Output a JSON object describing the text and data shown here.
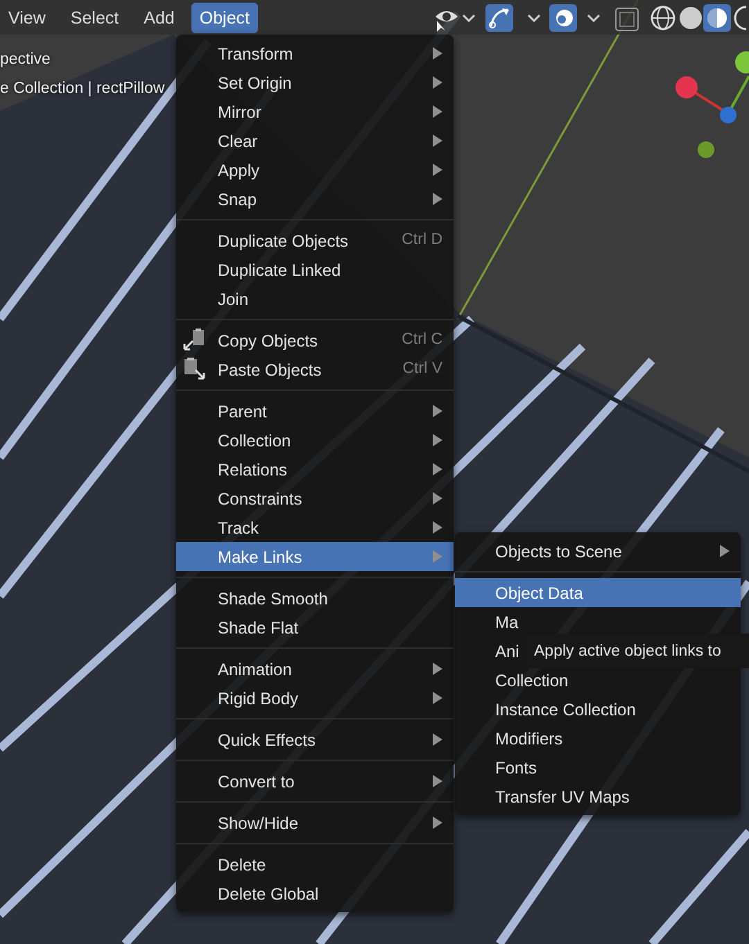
{
  "header": {
    "menus": [
      {
        "label": "View",
        "selected": false
      },
      {
        "label": "Select",
        "selected": false
      },
      {
        "label": "Add",
        "selected": false
      },
      {
        "label": "Object",
        "selected": true
      }
    ]
  },
  "viewport_overlay": [
    "pective",
    "e Collection | rectPillow"
  ],
  "object_menu": {
    "groups": [
      {
        "items": [
          {
            "label": "Transform",
            "submenu": true,
            "selected": false
          },
          {
            "label": "Set Origin",
            "submenu": true,
            "selected": false
          },
          {
            "label": "Mirror",
            "submenu": true,
            "selected": false
          },
          {
            "label": "Clear",
            "submenu": true,
            "selected": false
          },
          {
            "label": "Apply",
            "submenu": true,
            "selected": false
          },
          {
            "label": "Snap",
            "submenu": true,
            "selected": false
          }
        ]
      },
      {
        "items": [
          {
            "label": "Duplicate Objects",
            "shortcut": "Ctrl D",
            "submenu": false,
            "selected": false
          },
          {
            "label": "Duplicate Linked",
            "submenu": false,
            "selected": false
          },
          {
            "label": "Join",
            "submenu": false,
            "selected": false
          }
        ]
      },
      {
        "items": [
          {
            "label": "Copy Objects",
            "shortcut": "Ctrl C",
            "kind": "copy",
            "submenu": false,
            "selected": false
          },
          {
            "label": "Paste Objects",
            "shortcut": "Ctrl V",
            "kind": "paste",
            "submenu": false,
            "selected": false
          }
        ]
      },
      {
        "items": [
          {
            "label": "Parent",
            "submenu": true,
            "selected": false
          },
          {
            "label": "Collection",
            "submenu": true,
            "selected": false
          },
          {
            "label": "Relations",
            "submenu": true,
            "selected": false
          },
          {
            "label": "Constraints",
            "submenu": true,
            "selected": false
          },
          {
            "label": "Track",
            "submenu": true,
            "selected": false
          },
          {
            "label": "Make Links",
            "submenu": true,
            "selected": true
          }
        ]
      },
      {
        "items": [
          {
            "label": "Shade Smooth",
            "submenu": false,
            "selected": false
          },
          {
            "label": "Shade Flat",
            "submenu": false,
            "selected": false
          }
        ]
      },
      {
        "items": [
          {
            "label": "Animation",
            "submenu": true,
            "selected": false
          },
          {
            "label": "Rigid Body",
            "submenu": true,
            "selected": false
          }
        ]
      },
      {
        "items": [
          {
            "label": "Quick Effects",
            "submenu": true,
            "selected": false
          }
        ]
      },
      {
        "items": [
          {
            "label": "Convert to",
            "submenu": true,
            "selected": false
          }
        ]
      },
      {
        "items": [
          {
            "label": "Show/Hide",
            "submenu": true,
            "selected": false
          }
        ]
      },
      {
        "items": [
          {
            "label": "Delete",
            "submenu": false,
            "selected": false
          },
          {
            "label": "Delete Global",
            "submenu": false,
            "selected": false
          }
        ]
      }
    ]
  },
  "make_links_menu": {
    "groups": [
      {
        "items": [
          {
            "label": "Objects to Scene",
            "submenu": true,
            "selected": false
          }
        ]
      },
      {
        "items": [
          {
            "label": "Object Data",
            "submenu": false,
            "selected": true
          },
          {
            "label": "Ma",
            "submenu": false,
            "selected": false
          },
          {
            "label": "Ani",
            "submenu": false,
            "selected": false
          },
          {
            "label": "Collection",
            "submenu": false,
            "selected": false
          },
          {
            "label": "Instance Collection",
            "submenu": false,
            "selected": false
          },
          {
            "label": "Modifiers",
            "submenu": false,
            "selected": false
          },
          {
            "label": "Fonts",
            "submenu": false,
            "selected": false
          },
          {
            "label": "Transfer UV Maps",
            "submenu": false,
            "selected": false
          }
        ]
      }
    ]
  },
  "tooltip": "Apply active object links to"
}
